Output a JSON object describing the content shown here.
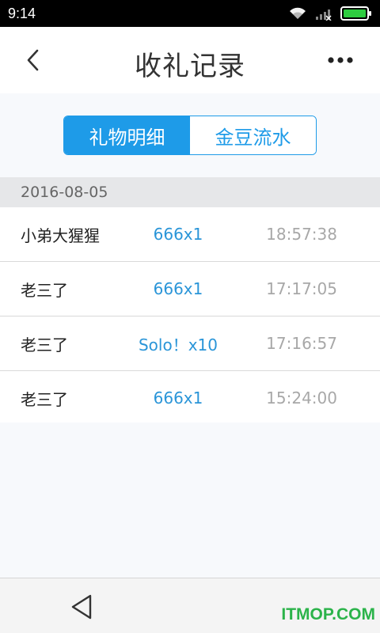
{
  "status_bar": {
    "time": "9:14",
    "icons": [
      "wifi-icon",
      "signal-icon",
      "battery-icon"
    ]
  },
  "header": {
    "title": "收礼记录",
    "back_icon": "chevron-left-icon",
    "more_icon": "more-horizontal-icon"
  },
  "tabs": [
    {
      "label": "礼物明细",
      "active": true
    },
    {
      "label": "金豆流水",
      "active": false
    }
  ],
  "date_group": "2016-08-05",
  "records": [
    {
      "name": "小弟大猩猩",
      "gift": "666x1",
      "time": "18:57:38"
    },
    {
      "name": "老三了",
      "gift": "666x1",
      "time": "17:17:05"
    },
    {
      "name": "老三了",
      "gift": "Solo！x10",
      "time": "17:16:57"
    },
    {
      "name": "老三了",
      "gift": "666x1",
      "time": "15:24:00"
    }
  ],
  "nav": {
    "back_icon": "triangle-back-icon"
  },
  "watermark": "ITMOP.COM",
  "colors": {
    "accent": "#1e9be8",
    "gift_text": "#2a95d8",
    "time_text": "#a8a8a8",
    "watermark": "#2bb34a"
  }
}
